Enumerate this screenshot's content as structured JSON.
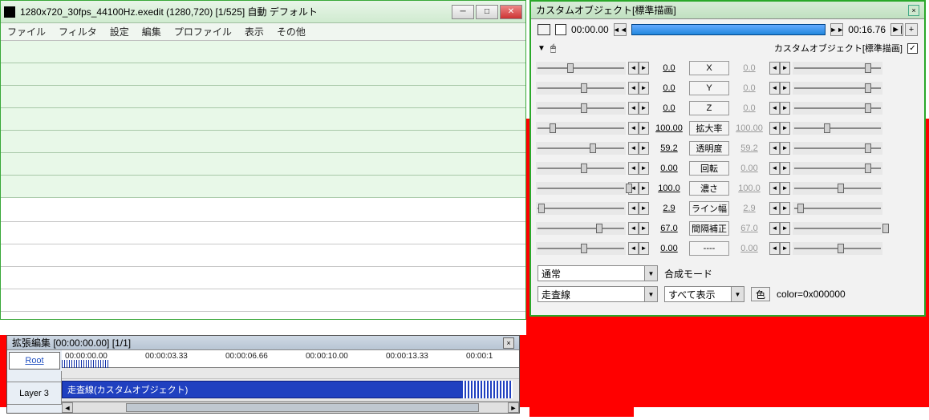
{
  "main": {
    "title": "1280x720_30fps_44100Hz.exedit (1280,720)  [1/525]  自動  デフォルト",
    "menu": [
      "ファイル",
      "フィルタ",
      "設定",
      "編集",
      "プロファイル",
      "表示",
      "その他"
    ]
  },
  "timeline": {
    "title": "拡張編集 [00:00:00.00] [1/1]",
    "root": "Root",
    "layer": "Layer 3",
    "ticks": [
      "00:00:00.00",
      "00:00:03.33",
      "00:00:06.66",
      "00:00:10.00",
      "00:00:13.33",
      "00:00:1"
    ],
    "clip": "走査線(カスタムオブジェクト)"
  },
  "prop": {
    "title": "カスタムオブジェクト[標準描画]",
    "t0": "00:00.00",
    "t1": "00:16.76",
    "sublabel": "カスタムオブジェクト[標準描画]",
    "params": [
      {
        "name": "X",
        "v0": "0.0",
        "v1": "0.0",
        "p0": 35,
        "p1": 80
      },
      {
        "name": "Y",
        "v0": "0.0",
        "v1": "0.0",
        "p0": 50,
        "p1": 80
      },
      {
        "name": "Z",
        "v0": "0.0",
        "v1": "0.0",
        "p0": 50,
        "p1": 80
      },
      {
        "name": "拡大率",
        "v0": "100.00",
        "v1": "100.00",
        "p0": 15,
        "p1": 35
      },
      {
        "name": "透明度",
        "v0": "59.2",
        "v1": "59.2",
        "p0": 60,
        "p1": 80
      },
      {
        "name": "回転",
        "v0": "0.00",
        "v1": "0.00",
        "p0": 50,
        "p1": 80
      },
      {
        "name": "濃さ",
        "v0": "100.0",
        "v1": "100.0",
        "p0": 100,
        "p1": 50
      },
      {
        "name": "ライン幅",
        "v0": "2.9",
        "v1": "2.9",
        "p0": 3,
        "p1": 5
      },
      {
        "name": "間隔補正",
        "v0": "67.0",
        "v1": "67.0",
        "p0": 67,
        "p1": 100
      },
      {
        "name": "----",
        "v0": "0.00",
        "v1": "0.00",
        "p0": 50,
        "p1": 50
      }
    ],
    "blend_label": "合成モード",
    "blend_value": "通常",
    "obj_value": "走査線",
    "show_value": "すべて表示",
    "color_label": "色",
    "color_value": "color=0x000000"
  }
}
